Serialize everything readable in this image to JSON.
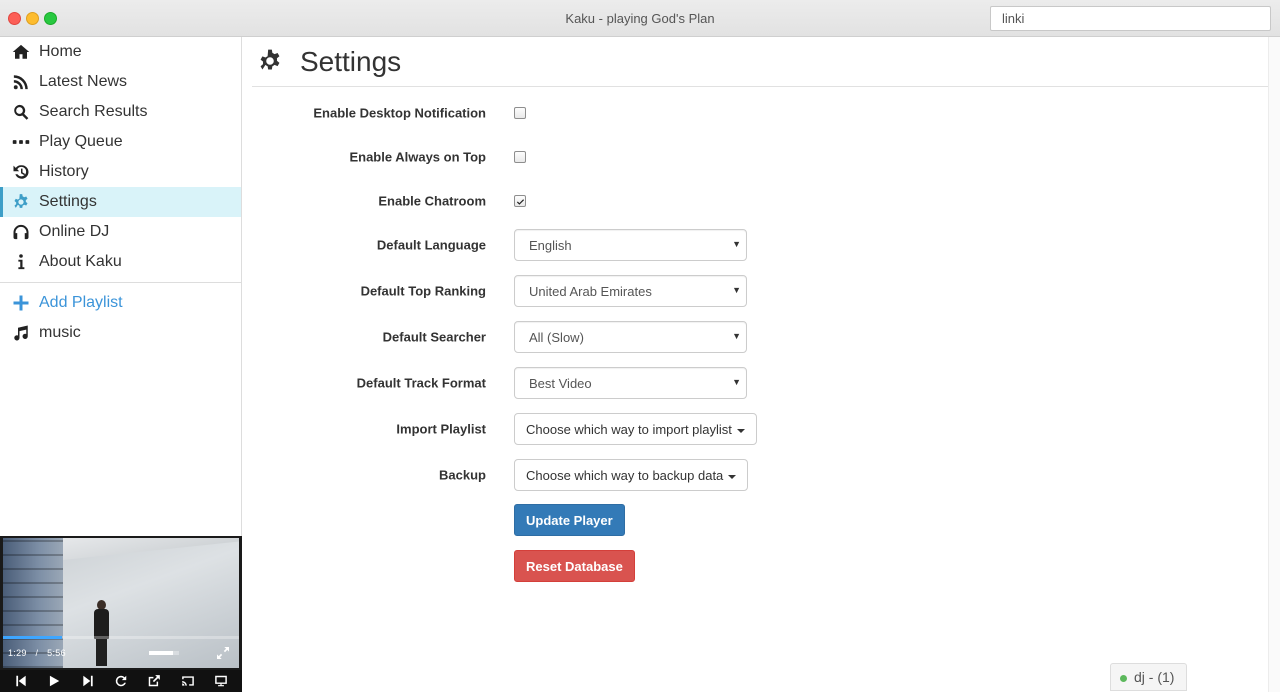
{
  "window": {
    "title": "Kaku - playing God's Plan",
    "search_value": "linki"
  },
  "sidebar": {
    "items": [
      {
        "label": "Home",
        "icon": "home-icon"
      },
      {
        "label": "Latest News",
        "icon": "rss-icon"
      },
      {
        "label": "Search Results",
        "icon": "search-icon"
      },
      {
        "label": "Play Queue",
        "icon": "ellipsis-icon"
      },
      {
        "label": "History",
        "icon": "history-icon"
      },
      {
        "label": "Settings",
        "icon": "gear-icon",
        "active": true
      },
      {
        "label": "Online DJ",
        "icon": "headphones-icon"
      },
      {
        "label": "About Kaku",
        "icon": "info-icon"
      }
    ],
    "add_playlist": "Add Playlist",
    "playlists": [
      {
        "label": "music",
        "icon": "music-note-icon"
      }
    ]
  },
  "player": {
    "current_time": "1:29",
    "separator": "/",
    "duration": "5:56",
    "progress_fraction": 0.25,
    "volume_fraction": 0.8
  },
  "settings": {
    "title": "Settings",
    "desktop_notification": {
      "label": "Enable Desktop Notification",
      "checked": false
    },
    "always_on_top": {
      "label": "Enable Always on Top",
      "checked": false
    },
    "chatroom": {
      "label": "Enable Chatroom",
      "checked": true
    },
    "language": {
      "label": "Default Language",
      "value": "English"
    },
    "top_ranking": {
      "label": "Default Top Ranking",
      "value": "United Arab Emirates"
    },
    "searcher": {
      "label": "Default Searcher",
      "value": "All (Slow)"
    },
    "track_format": {
      "label": "Default Track Format",
      "value": "Best Video"
    },
    "import_playlist": {
      "label": "Import Playlist",
      "value": "Choose which way to import playlist"
    },
    "backup": {
      "label": "Backup",
      "value": "Choose which way to backup data"
    },
    "update_player_label": "Update Player",
    "reset_database_label": "Reset Database"
  },
  "status": {
    "online_label": "dj - (1)",
    "online_color": "#5cb85c"
  },
  "colors": {
    "accent": "#3d9ec7",
    "primary_button": "#337ab7",
    "danger_button": "#d9534f",
    "active_nav_bg": "#d9f3f9"
  }
}
